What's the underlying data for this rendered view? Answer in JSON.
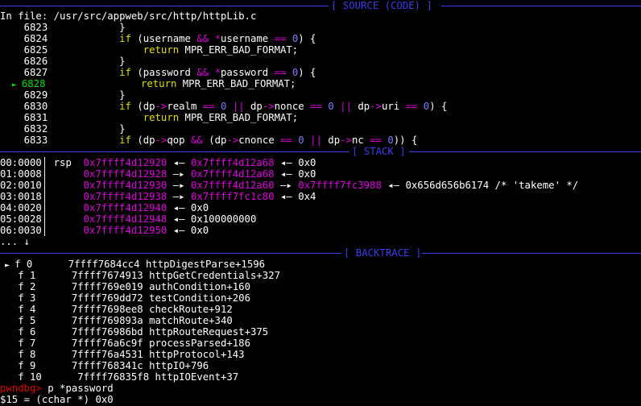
{
  "colors": {
    "rule": "#3c3cf0",
    "keyword": "#e0e000",
    "operator": "#e000e0",
    "number": "#7b7bff",
    "current": "#00e000",
    "address": "#c000c0",
    "prompt": "#e00000"
  },
  "source": {
    "header": "[ SOURCE (CODE) ]",
    "file": "In file: /usr/src/appweb/src/http/httpLib.c",
    "lines": [
      {
        "no": "6823",
        "parts": [
          {
            "t": "        }",
            "c": "ln"
          }
        ]
      },
      {
        "no": "6824",
        "parts": [
          {
            "t": "        ",
            "c": "ln"
          },
          {
            "t": "if",
            "c": "kw"
          },
          {
            "t": " (username ",
            "c": "ln"
          },
          {
            "t": "&&",
            "c": "op"
          },
          {
            "t": " ",
            "c": "ln"
          },
          {
            "t": "*",
            "c": "op"
          },
          {
            "t": "username ",
            "c": "ln"
          },
          {
            "t": "==",
            "c": "op"
          },
          {
            "t": " ",
            "c": "ln"
          },
          {
            "t": "0",
            "c": "num"
          },
          {
            "t": ") {",
            "c": "ln"
          }
        ]
      },
      {
        "no": "6825",
        "parts": [
          {
            "t": "            ",
            "c": "ln"
          },
          {
            "t": "return",
            "c": "kw"
          },
          {
            "t": " MPR_ERR_BAD_FORMAT;",
            "c": "ln"
          }
        ]
      },
      {
        "no": "6826",
        "parts": [
          {
            "t": "        }",
            "c": "ln"
          }
        ]
      },
      {
        "no": "6827",
        "parts": [
          {
            "t": "        ",
            "c": "ln"
          },
          {
            "t": "if",
            "c": "kw"
          },
          {
            "t": " (password ",
            "c": "ln"
          },
          {
            "t": "&&",
            "c": "op"
          },
          {
            "t": " ",
            "c": "ln"
          },
          {
            "t": "*",
            "c": "op"
          },
          {
            "t": "password ",
            "c": "ln"
          },
          {
            "t": "==",
            "c": "op"
          },
          {
            "t": " ",
            "c": "ln"
          },
          {
            "t": "0",
            "c": "num"
          },
          {
            "t": ") {",
            "c": "ln"
          }
        ]
      },
      {
        "no": "6828",
        "current": true,
        "marker": "►",
        "parts": [
          {
            "t": "            ",
            "c": "ln"
          },
          {
            "t": "return",
            "c": "kw"
          },
          {
            "t": " MPR_ERR_BAD_FORMAT;",
            "c": "ln"
          }
        ]
      },
      {
        "no": "6829",
        "parts": [
          {
            "t": "        }",
            "c": "ln"
          }
        ]
      },
      {
        "no": "6830",
        "parts": [
          {
            "t": "        ",
            "c": "ln"
          },
          {
            "t": "if",
            "c": "kw"
          },
          {
            "t": " (dp",
            "c": "ln"
          },
          {
            "t": "->",
            "c": "op"
          },
          {
            "t": "realm ",
            "c": "ln"
          },
          {
            "t": "==",
            "c": "op"
          },
          {
            "t": " ",
            "c": "ln"
          },
          {
            "t": "0",
            "c": "num"
          },
          {
            "t": " ",
            "c": "ln"
          },
          {
            "t": "||",
            "c": "op"
          },
          {
            "t": " dp",
            "c": "ln"
          },
          {
            "t": "->",
            "c": "op"
          },
          {
            "t": "nonce ",
            "c": "ln"
          },
          {
            "t": "==",
            "c": "op"
          },
          {
            "t": " ",
            "c": "ln"
          },
          {
            "t": "0",
            "c": "num"
          },
          {
            "t": " ",
            "c": "ln"
          },
          {
            "t": "||",
            "c": "op"
          },
          {
            "t": " dp",
            "c": "ln"
          },
          {
            "t": "->",
            "c": "op"
          },
          {
            "t": "uri ",
            "c": "ln"
          },
          {
            "t": "==",
            "c": "op"
          },
          {
            "t": " ",
            "c": "ln"
          },
          {
            "t": "0",
            "c": "num"
          },
          {
            "t": ") {",
            "c": "ln"
          }
        ]
      },
      {
        "no": "6831",
        "parts": [
          {
            "t": "            ",
            "c": "ln"
          },
          {
            "t": "return",
            "c": "kw"
          },
          {
            "t": " MPR_ERR_BAD_FORMAT;",
            "c": "ln"
          }
        ]
      },
      {
        "no": "6832",
        "parts": [
          {
            "t": "        }",
            "c": "ln"
          }
        ]
      },
      {
        "no": "6833",
        "parts": [
          {
            "t": "        ",
            "c": "ln"
          },
          {
            "t": "if",
            "c": "kw"
          },
          {
            "t": " (dp",
            "c": "ln"
          },
          {
            "t": "->",
            "c": "op"
          },
          {
            "t": "qop ",
            "c": "ln"
          },
          {
            "t": "&&",
            "c": "op"
          },
          {
            "t": " (dp",
            "c": "ln"
          },
          {
            "t": "->",
            "c": "op"
          },
          {
            "t": "cnonce ",
            "c": "ln"
          },
          {
            "t": "==",
            "c": "op"
          },
          {
            "t": " ",
            "c": "ln"
          },
          {
            "t": "0",
            "c": "num"
          },
          {
            "t": " ",
            "c": "ln"
          },
          {
            "t": "||",
            "c": "op"
          },
          {
            "t": " dp",
            "c": "ln"
          },
          {
            "t": "->",
            "c": "op"
          },
          {
            "t": "nc ",
            "c": "ln"
          },
          {
            "t": "==",
            "c": "op"
          },
          {
            "t": " ",
            "c": "ln"
          },
          {
            "t": "0",
            "c": "num"
          },
          {
            "t": ")) {",
            "c": "ln"
          }
        ]
      }
    ]
  },
  "stack": {
    "header": "[ STACK ]",
    "rows": [
      {
        "parts": [
          {
            "t": "00:0000",
            "c": "ln"
          },
          {
            "t": "│ ",
            "c": "ln"
          },
          {
            "t": "rsp  ",
            "c": "ln"
          },
          {
            "t": "0x7ffff4d12920",
            "c": "stk"
          },
          {
            "t": " ◂— ",
            "c": "ln"
          },
          {
            "t": "0x7ffff4d12a68",
            "c": "stk"
          },
          {
            "t": " ◂— 0x0",
            "c": "ln"
          }
        ]
      },
      {
        "parts": [
          {
            "t": "01:0008",
            "c": "ln"
          },
          {
            "t": "│      ",
            "c": "ln"
          },
          {
            "t": "0x7ffff4d12928",
            "c": "stk"
          },
          {
            "t": " —▸ ",
            "c": "ln"
          },
          {
            "t": "0x7ffff4d12a68",
            "c": "stk"
          },
          {
            "t": " ◂— 0x0",
            "c": "ln"
          }
        ]
      },
      {
        "parts": [
          {
            "t": "02:0010",
            "c": "ln"
          },
          {
            "t": "│      ",
            "c": "ln"
          },
          {
            "t": "0x7ffff4d12930",
            "c": "stk"
          },
          {
            "t": " —▸ ",
            "c": "ln"
          },
          {
            "t": "0x7ffff4d12a60",
            "c": "stk"
          },
          {
            "t": " —▸ ",
            "c": "ln"
          },
          {
            "t": "0x7ffff7fc3988",
            "c": "stk"
          },
          {
            "t": " ◂— 0x656d656b6174 /* 'takeme' */",
            "c": "ln"
          }
        ]
      },
      {
        "parts": [
          {
            "t": "03:0018",
            "c": "ln"
          },
          {
            "t": "│      ",
            "c": "ln"
          },
          {
            "t": "0x7ffff4d12938",
            "c": "stk"
          },
          {
            "t": " —▸ ",
            "c": "ln"
          },
          {
            "t": "0x7ffff7fc1c80",
            "c": "stk"
          },
          {
            "t": " ◂— 0x4",
            "c": "ln"
          }
        ]
      },
      {
        "parts": [
          {
            "t": "04:0020",
            "c": "ln"
          },
          {
            "t": "│      ",
            "c": "ln"
          },
          {
            "t": "0x7ffff4d12940",
            "c": "stk"
          },
          {
            "t": " ◂— 0x0",
            "c": "ln"
          }
        ]
      },
      {
        "parts": [
          {
            "t": "05:0028",
            "c": "ln"
          },
          {
            "t": "│      ",
            "c": "ln"
          },
          {
            "t": "0x7ffff4d12948",
            "c": "stk"
          },
          {
            "t": " ◂— 0x100000000",
            "c": "ln"
          }
        ]
      },
      {
        "parts": [
          {
            "t": "06:0030",
            "c": "ln"
          },
          {
            "t": "│      ",
            "c": "ln"
          },
          {
            "t": "0x7ffff4d12950",
            "c": "stk"
          },
          {
            "t": " ◂— 0x0",
            "c": "ln"
          }
        ]
      },
      {
        "parts": [
          {
            "t": "... ↓",
            "c": "ln"
          }
        ]
      }
    ]
  },
  "backtrace": {
    "header": "[ BACKTRACE ]",
    "frames": [
      {
        "marker": "►",
        "f": "f 0 ",
        "addr": "7ffff7684cc4",
        "sym": "httpDigestParse+1596"
      },
      {
        "marker": " ",
        "f": "f 1 ",
        "addr": "7ffff7674913",
        "sym": "httpGetCredentials+327"
      },
      {
        "marker": " ",
        "f": "f 2 ",
        "addr": "7ffff769e019",
        "sym": "authCondition+160"
      },
      {
        "marker": " ",
        "f": "f 3 ",
        "addr": "7ffff769dd72",
        "sym": "testCondition+206"
      },
      {
        "marker": " ",
        "f": "f 4 ",
        "addr": "7ffff7698ee8",
        "sym": "checkRoute+912"
      },
      {
        "marker": " ",
        "f": "f 5 ",
        "addr": "7ffff769893a",
        "sym": "matchRoute+340"
      },
      {
        "marker": " ",
        "f": "f 6 ",
        "addr": "7ffff76986bd",
        "sym": "httpRouteRequest+375"
      },
      {
        "marker": " ",
        "f": "f 7 ",
        "addr": "7ffff76a6c9f",
        "sym": "processParsed+186"
      },
      {
        "marker": " ",
        "f": "f 8 ",
        "addr": "7ffff76a4531",
        "sym": "httpProtocol+143"
      },
      {
        "marker": " ",
        "f": "f 9 ",
        "addr": "7ffff768341c",
        "sym": "httpIO+796"
      },
      {
        "marker": " ",
        "f": "f 10",
        "addr": " 7ffff76835f8",
        "sym": "httpIOEvent+37"
      }
    ]
  },
  "console": {
    "prompt": "pwndbg>",
    "command": " p *password",
    "output": "$15 = (cchar *) 0x0"
  }
}
